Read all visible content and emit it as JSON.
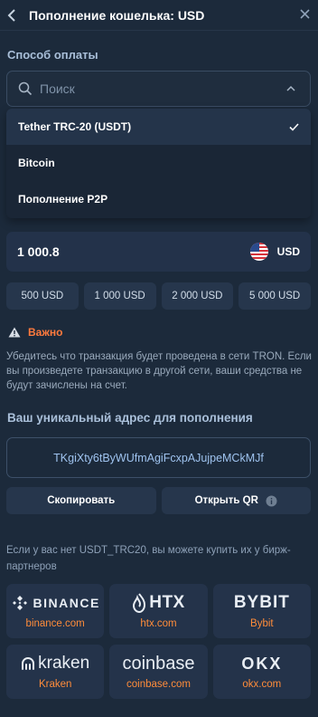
{
  "header": {
    "title": "Пополнение кошелька: USD",
    "back_icon": "chevron-left-icon",
    "close_icon": "close-icon"
  },
  "payment": {
    "label": "Способ оплаты",
    "search_placeholder": "Поиск",
    "options": [
      {
        "label": "Tether TRC-20 (USDT)",
        "selected": true
      },
      {
        "label": "Bitcoin",
        "selected": false
      },
      {
        "label": "Пополнение P2P",
        "selected": false
      }
    ]
  },
  "amount": {
    "value": "1 000.8",
    "currency": "USD"
  },
  "presets": [
    "500 USD",
    "1 000 USD",
    "2 000 USD",
    "5 000 USD"
  ],
  "warning": {
    "title": "Важно",
    "text": "Убедитесь что транзакция будет проведена в сети TRON. Если вы произведете транзакцию в другой сети, ваши средства не будут зачислены на счет."
  },
  "address": {
    "label": "Ваш уникальный адрес для пополнения",
    "value": "TKgiXty6tByWUfmAgiFcxpAJujpeMCkMJf"
  },
  "actions": {
    "copy": "Скопировать",
    "qr": "Открыть QR"
  },
  "partners": {
    "text": "Если у вас нет USDT_TRC20, вы можете купить их у бирж-партнеров",
    "items": [
      {
        "logo": "BINANCE",
        "label": "binance.com"
      },
      {
        "logo": "HTX",
        "label": "htx.com"
      },
      {
        "logo": "BYBIT",
        "label": "Bybit"
      },
      {
        "logo": "kraken",
        "label": "Kraken"
      },
      {
        "logo": "coinbase",
        "label": "coinbase.com"
      },
      {
        "logo": "OKX",
        "label": "okx.com"
      }
    ]
  },
  "colors": {
    "background": "#1c2a3b",
    "accent_orange": "#ff8c3a",
    "warning": "#ff7a3d",
    "link_blue": "#9fc3ef"
  }
}
